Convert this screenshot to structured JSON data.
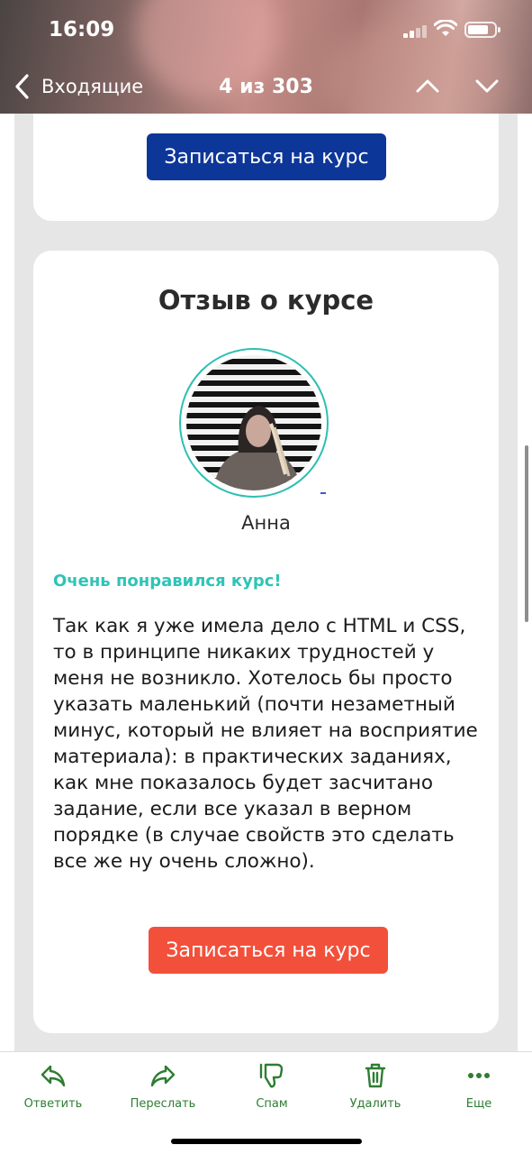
{
  "status_bar": {
    "time": "16:09"
  },
  "nav": {
    "back_label": "Входящие",
    "counter": "4 из 303"
  },
  "cards": {
    "top_button": "Записаться на курс",
    "review": {
      "title": "Отзыв о курсе",
      "reviewer_name": "Анна",
      "heading": "Очень понравился курс!",
      "body": "Так как я уже имела дело с HTML и CSS, то в принципе никаких трудностей у меня не возникло. Хотелось бы просто указать маленький (почти незаметный минус, который не влияет на восприятие материала): в практических заданиях, как мне показалось будет засчитано задание, если все указал в верном порядке (в случае свойств это сделать все же ну очень сложно).",
      "button": "Записаться на курс"
    }
  },
  "toolbar": [
    {
      "label": "Ответить",
      "icon": "reply-icon"
    },
    {
      "label": "Переслать",
      "icon": "forward-icon"
    },
    {
      "label": "Спам",
      "icon": "thumbs-down-icon"
    },
    {
      "label": "Удалить",
      "icon": "trash-icon"
    },
    {
      "label": "Еще",
      "icon": "more-icon"
    }
  ],
  "colors": {
    "accent_blue": "#0d3699",
    "accent_red": "#f2503b",
    "accent_teal": "#2ec4b6",
    "toolbar_green": "#2e7d32"
  }
}
